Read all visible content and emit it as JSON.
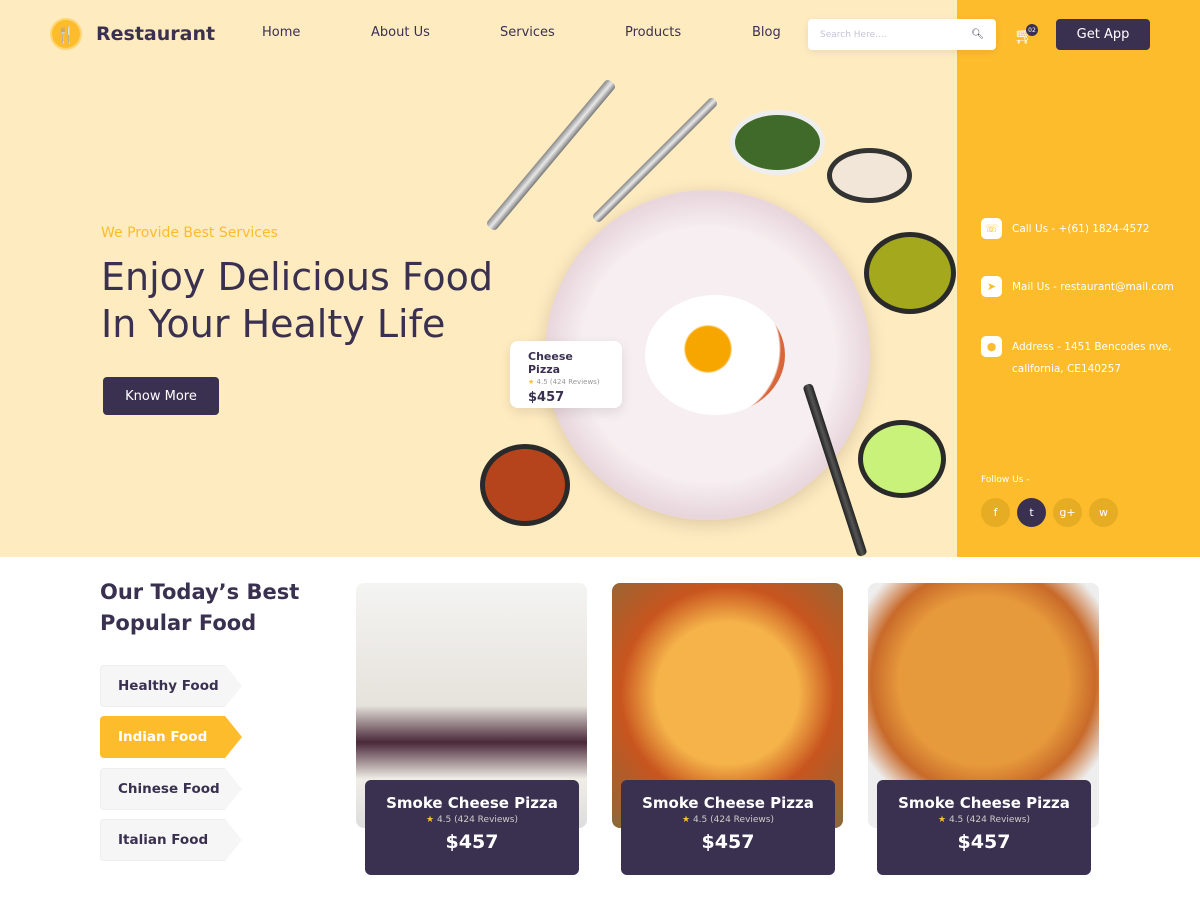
{
  "brand": "Restaurant",
  "nav": [
    "Home",
    "About Us",
    "Services",
    "Products",
    "Blog"
  ],
  "search": {
    "placeholder": "Search Here...."
  },
  "cart": {
    "count": "02"
  },
  "get_app": "Get App",
  "hero": {
    "subtitle": "We Provide Best Services",
    "title_line1": "Enjoy Delicious Food",
    "title_line2": "In Your Healty Life",
    "cta": "Know More"
  },
  "featured": {
    "name": "Cheese Pizza",
    "rating": "4.5 (424 Reviews)",
    "price": "$457"
  },
  "contact": {
    "call": "Call Us - +(61) 1824-4572",
    "mail": "Mail Us - restaurant@mail.com",
    "address1": "Address - 1451 Bencodes nve,",
    "address2": "california, CE140257",
    "follow": "Follow Us -"
  },
  "social": [
    {
      "icon": "facebook-icon",
      "glyph": "f"
    },
    {
      "icon": "twitter-icon",
      "glyph": "t"
    },
    {
      "icon": "google-plus-icon",
      "glyph": "g+"
    },
    {
      "icon": "whatsapp-icon",
      "glyph": "w"
    }
  ],
  "popular": {
    "title_line1": "Our Today’s Best",
    "title_line2": "Popular Food",
    "tabs": [
      "Healthy Food",
      "Indian Food",
      "Chinese Food",
      "Italian Food"
    ],
    "active_tab": "Indian Food"
  },
  "foods": [
    {
      "name": "Smoke Cheese Pizza",
      "rating": "4.5 (424 Reviews)",
      "price": "$457"
    },
    {
      "name": "Smoke Cheese Pizza",
      "rating": "4.5 (424 Reviews)",
      "price": "$457"
    },
    {
      "name": "Smoke Cheese Pizza",
      "rating": "4.5 (424 Reviews)",
      "price": "$457"
    }
  ],
  "colors": {
    "accent": "#fdbc2c",
    "dark": "#3a3150",
    "cream": "#ffebc0"
  }
}
